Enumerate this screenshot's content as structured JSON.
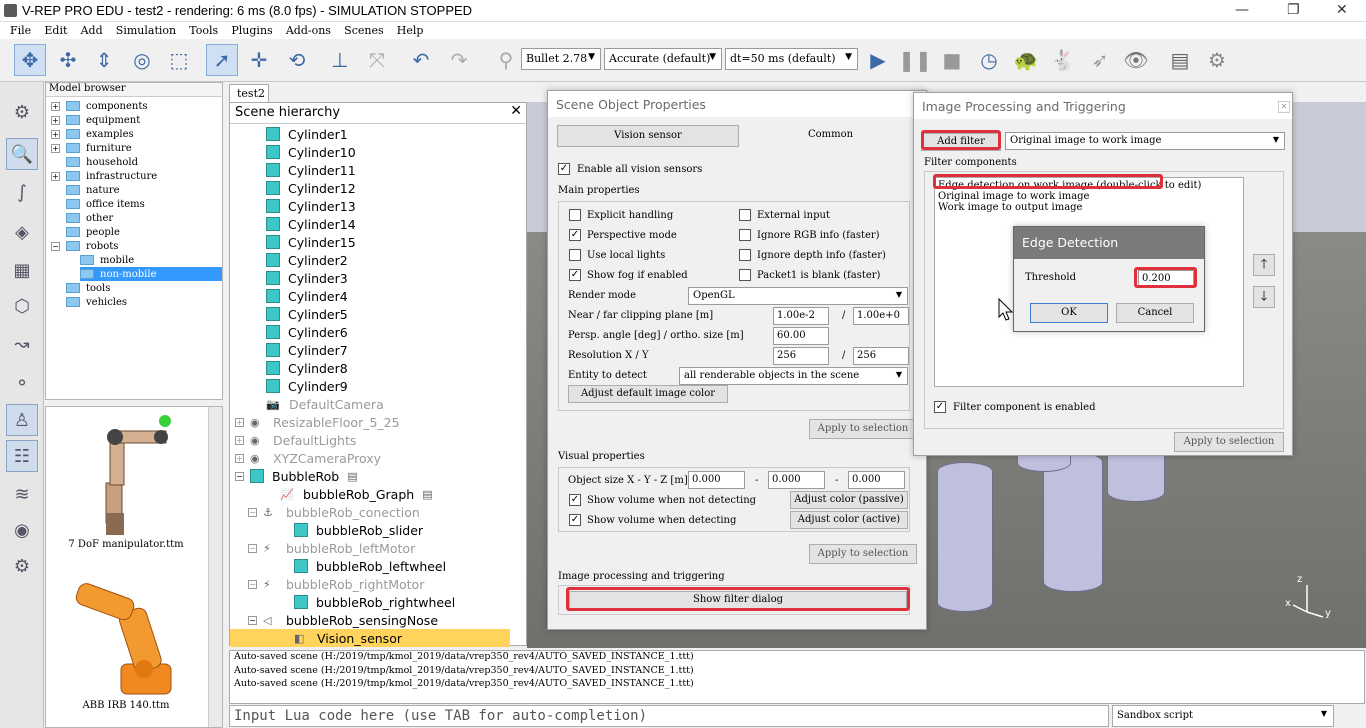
{
  "window": {
    "title": "V-REP PRO EDU - test2 - rendering: 6 ms (8.0 fps) - SIMULATION STOPPED"
  },
  "menu": [
    "File",
    "Edit",
    "Add",
    "Simulation",
    "Tools",
    "Plugins",
    "Add-ons",
    "Scenes",
    "Help"
  ],
  "toolbar": {
    "engine": "Bullet 2.78",
    "accuracy": "Accurate (default)",
    "dt": "dt=50 ms (default)"
  },
  "model_browser": {
    "header": "Model browser",
    "folders": [
      "components",
      "equipment",
      "examples",
      "furniture",
      "household",
      "infrastructure",
      "nature",
      "office items",
      "other",
      "people",
      "robots",
      "mobile",
      "non-mobile",
      "tools",
      "vehicles"
    ],
    "thumbs": [
      "7 DoF manipulator.ttm",
      "ABB IRB 140.ttm"
    ]
  },
  "scene_tab": "test2",
  "hierarchy": {
    "title": "Scene hierarchy",
    "items": [
      "Cylinder1",
      "Cylinder10",
      "Cylinder11",
      "Cylinder12",
      "Cylinder13",
      "Cylinder14",
      "Cylinder15",
      "Cylinder2",
      "Cylinder3",
      "Cylinder4",
      "Cylinder5",
      "Cylinder6",
      "Cylinder7",
      "Cylinder8",
      "Cylinder9",
      "DefaultCamera",
      "ResizableFloor_5_25",
      "DefaultLights",
      "XYZCameraProxy",
      "BubbleRob",
      "bubbleRob_Graph",
      "bubbleRob_conection",
      "bubbleRob_slider",
      "bubbleRob_leftMotor",
      "bubbleRob_leftwheel",
      "bubbleRob_rightMotor",
      "bubbleRob_rightwheel",
      "bubbleRob_sensingNose",
      "Vision_sensor"
    ]
  },
  "sop": {
    "title": "Scene Object Properties",
    "tab_vision": "Vision sensor",
    "tab_common": "Common",
    "enable_all": "Enable all vision sensors",
    "main_props": "Main properties",
    "explicit": "Explicit handling",
    "external": "External input",
    "perspective": "Perspective mode",
    "ignore_rgb": "Ignore RGB info (faster)",
    "local_lights": "Use local lights",
    "ignore_depth": "Ignore depth  info (faster)",
    "fog": "Show fog if enabled",
    "packet1": "Packet1 is blank (faster)",
    "render_mode_label": "Render mode",
    "render_mode": "OpenGL",
    "clip_label": "Near / far clipping plane [m]",
    "near": "1.00e-2",
    "far": "1.00e+0",
    "persp_label": "Persp. angle [deg] / ortho. size [m]",
    "persp": "60.00",
    "res_label": "Resolution X / Y",
    "res_x": "256",
    "res_y": "256",
    "entity_label": "Entity to detect",
    "entity": "all renderable objects in the scene",
    "adjust_default": "Adjust default image color",
    "apply1": "Apply to selection",
    "visual_props": "Visual properties",
    "objsize_label": "Object size X - Y - Z [m]",
    "sx": "0.000",
    "sy": "0.000",
    "sz": "0.000",
    "show_vol_nd": "Show volume when not detecting",
    "show_vol_d": "Show volume when detecting",
    "adj_passive": "Adjust color (passive)",
    "adj_active": "Adjust color (active)",
    "apply2": "Apply to selection",
    "img_proc": "Image processing and triggering",
    "show_filter": "Show filter dialog",
    "slash": "/",
    "dash": "-"
  },
  "ipt": {
    "title": "Image Processing and Triggering",
    "add_filter": "Add filter",
    "filter_choice": "Original image to work image",
    "filter_components": "Filter components",
    "filters": [
      "Edge detection on work image (double-click to edit)",
      "Original image to work image",
      "Work image to output image"
    ],
    "enabled": "Filter component is enabled",
    "apply": "Apply to selection"
  },
  "edge": {
    "title": "Edge Detection",
    "threshold_label": "Threshold",
    "threshold": "0.200",
    "ok": "OK",
    "cancel": "Cancel"
  },
  "console": [
    "Auto-saved scene (H:/2019/tmp/kmol_2019/data/vrep350_rev4/AUTO_SAVED_INSTANCE_1.ttt)",
    "Auto-saved scene (H:/2019/tmp/kmol_2019/data/vrep350_rev4/AUTO_SAVED_INSTANCE_1.ttt)",
    "Auto-saved scene (H:/2019/tmp/kmol_2019/data/vrep350_rev4/AUTO_SAVED_INSTANCE_1.ttt)"
  ],
  "lua_placeholder": "Input Lua code here (use TAB for auto-completion)",
  "script_select": "Sandbox script",
  "axes": {
    "x": "x",
    "y": "y",
    "z": "z"
  },
  "colors": {
    "highlight": "#e0303c",
    "selection": "#ffd35c",
    "cylinder": "#bfc0de"
  }
}
